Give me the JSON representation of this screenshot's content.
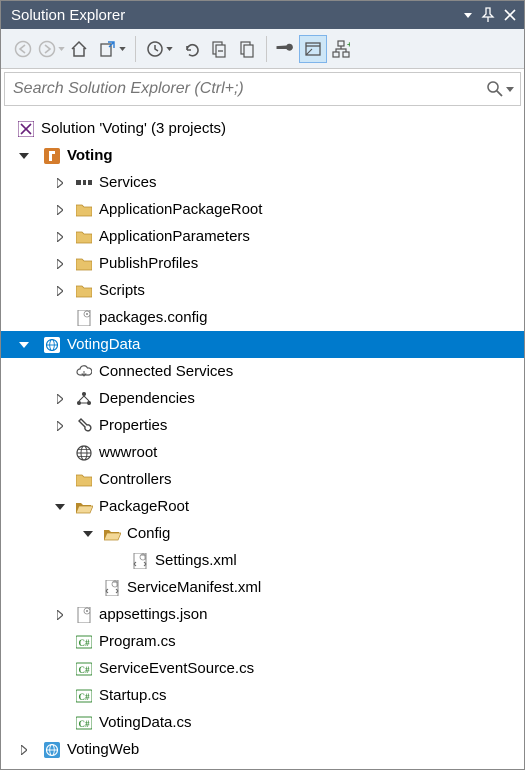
{
  "title": "Solution Explorer",
  "search": {
    "placeholder": "Search Solution Explorer (Ctrl+;)"
  },
  "tree": {
    "solution": "Solution 'Voting' (3 projects)",
    "voting": "Voting",
    "voting_items": {
      "services": "Services",
      "appPkgRoot": "ApplicationPackageRoot",
      "appParams": "ApplicationParameters",
      "pubProfiles": "PublishProfiles",
      "scripts": "Scripts",
      "pkgConfig": "packages.config"
    },
    "votingData": "VotingData",
    "votingData_items": {
      "connSvc": "Connected Services",
      "deps": "Dependencies",
      "props": "Properties",
      "wwwroot": "wwwroot",
      "controllers": "Controllers",
      "pkgRoot": "PackageRoot",
      "config": "Config",
      "settingsXml": "Settings.xml",
      "svcManifest": "ServiceManifest.xml",
      "appsettings": "appsettings.json",
      "program": "Program.cs",
      "svcEventSrc": "ServiceEventSource.cs",
      "startup": "Startup.cs",
      "votingDataCs": "VotingData.cs"
    },
    "votingWeb": "VotingWeb"
  }
}
